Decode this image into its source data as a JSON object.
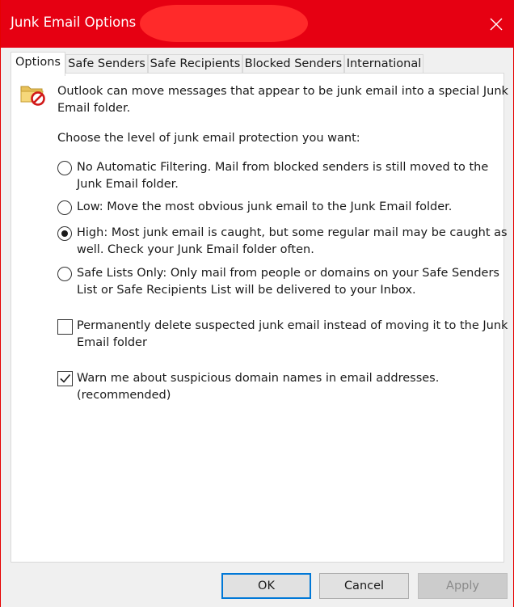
{
  "window": {
    "title": "Junk Email Options -"
  },
  "tabs": [
    {
      "label": "Options",
      "active": true
    },
    {
      "label": "Safe Senders",
      "active": false
    },
    {
      "label": "Safe Recipients",
      "active": false
    },
    {
      "label": "Blocked Senders",
      "active": false
    },
    {
      "label": "International",
      "active": false
    }
  ],
  "options": {
    "intro_line1": "Outlook can move messages that appear to be junk email into a special Junk",
    "intro_line2": "Email folder.",
    "level_prompt": "Choose the level of junk email protection you want:",
    "levels": [
      {
        "line1": "No Automatic Filtering. Mail from blocked senders is still moved to the",
        "line2": "Junk Email folder.",
        "selected": false
      },
      {
        "line1": "Low: Move the most obvious junk email to the Junk Email folder.",
        "line2": "",
        "selected": false
      },
      {
        "line1": "High: Most junk email is caught, but some regular mail may be caught as",
        "line2": "well. Check your Junk Email folder often.",
        "selected": true
      },
      {
        "line1": "Safe Lists Only: Only mail from people or domains on your Safe Senders",
        "line2": "List or Safe Recipients List will be delivered to your Inbox.",
        "selected": false
      }
    ],
    "permanent_delete": {
      "line1": "Permanently delete suspected junk email instead of moving it to the Junk",
      "line2": "Email folder",
      "checked": false
    },
    "warn_domains": {
      "line1": "Warn me about suspicious domain names in email addresses.",
      "line2": "(recommended)",
      "checked": true
    }
  },
  "buttons": {
    "ok": "OK",
    "cancel": "Cancel",
    "apply": "Apply"
  },
  "colors": {
    "titlebar": "#e60012",
    "accent": "#0078d7"
  },
  "icons": {
    "folder": "junk-folder-icon",
    "close": "close-icon"
  }
}
